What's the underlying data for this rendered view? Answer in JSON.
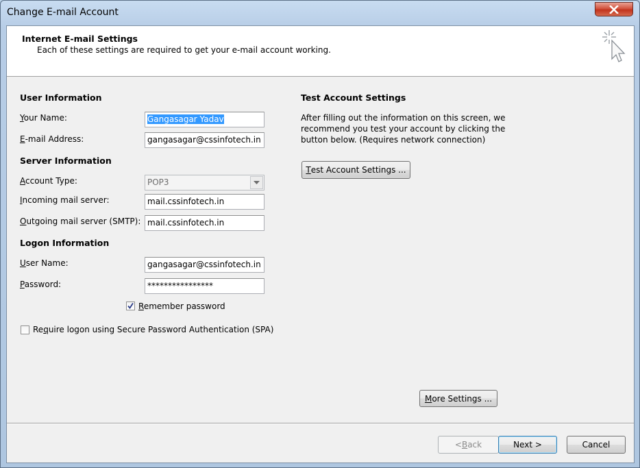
{
  "window": {
    "title": "Change E-mail Account",
    "close_icon": "close-icon"
  },
  "header": {
    "title": "Internet E-mail Settings",
    "subtitle": "Each of these settings are required to get your e-mail account working."
  },
  "user_info": {
    "section_title": "User Information",
    "name_label_key": "Y",
    "name_label_rest": "our Name:",
    "name_value": "Gangasagar Yadav",
    "email_label_key": "E",
    "email_label_rest": "-mail Address:",
    "email_value": "gangasagar@cssinfotech.in"
  },
  "server_info": {
    "section_title": "Server Information",
    "account_type_label_key": "A",
    "account_type_label_rest": "ccount Type:",
    "account_type_value": "POP3",
    "incoming_label_key": "I",
    "incoming_label_rest": "ncoming mail server:",
    "incoming_value": "mail.cssinfotech.in",
    "outgoing_label_key": "O",
    "outgoing_label_rest": "utgoing mail server (SMTP):",
    "outgoing_value": "mail.cssinfotech.in"
  },
  "logon_info": {
    "section_title": "Logon Information",
    "username_label_key": "U",
    "username_label_rest": "ser Name:",
    "username_value": "gangasagar@cssinfotech.in",
    "password_label_key": "P",
    "password_label_rest": "assword:",
    "password_value": "****************",
    "remember_key": "R",
    "remember_rest": "emember password",
    "remember_checked": true,
    "spa_pre": "Re",
    "spa_key": "q",
    "spa_rest": "uire logon using Secure Password Authentication (SPA)",
    "spa_checked": false
  },
  "test_settings": {
    "section_title": "Test Account Settings",
    "description": "After filling out the information on this screen, we recommend you test your account by clicking the button below. (Requires network connection)",
    "button_key": "T",
    "button_rest": "est Account Settings ..."
  },
  "buttons": {
    "more_key": "M",
    "more_rest": "ore Settings ...",
    "back_pre": "< ",
    "back_key": "B",
    "back_rest": "ack",
    "next_label": "Next >",
    "cancel_label": "Cancel"
  }
}
